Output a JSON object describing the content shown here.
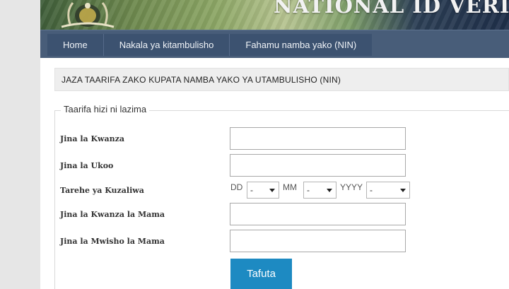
{
  "header": {
    "title": "NATIONAL ID VERIFICAT"
  },
  "nav": {
    "tabs": [
      {
        "label": "Home"
      },
      {
        "label": "Nakala ya kitambulisho"
      },
      {
        "label": "Fahamu namba yako (NIN)"
      }
    ]
  },
  "notice": {
    "text": "JAZA TAARIFA ZAKO KUPATA NAMBA YAKO YA UTAMBULISHO (NIN)"
  },
  "form": {
    "legend": "Taarifa hizi ni lazima",
    "first_name_label": "Jina la Kwanza",
    "first_name_value": "",
    "surname_label": "Jina la Ukoo",
    "surname_value": "",
    "dob_label": "Tarehe ya Kuzaliwa",
    "dd_label": "DD",
    "dd_value": "-",
    "mm_label": "MM",
    "mm_value": "-",
    "yyyy_label": "YYYY",
    "yyyy_value": "-",
    "mother_first_label": "Jina la Kwanza la Mama",
    "mother_first_value": "",
    "mother_last_label": "Jina la Mwisho la Mama",
    "mother_last_value": "",
    "submit_label": "Tafuta"
  },
  "colors": {
    "nav_bg": "#485d79",
    "button_bg": "#1d8ac2",
    "notice_bg": "#eeeeee"
  },
  "icons": {
    "emblem": "coat-of-arms-icon"
  }
}
